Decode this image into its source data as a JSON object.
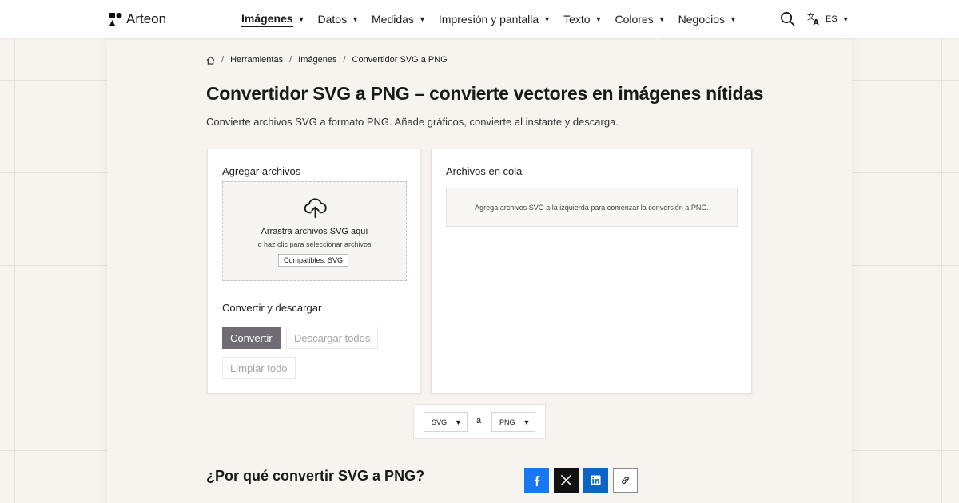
{
  "brand": {
    "name": "Arteon"
  },
  "nav": {
    "items": [
      {
        "label": "Imágenes",
        "active": true
      },
      {
        "label": "Datos"
      },
      {
        "label": "Medidas"
      },
      {
        "label": "Impresión y pantalla"
      },
      {
        "label": "Texto"
      },
      {
        "label": "Colores"
      },
      {
        "label": "Negocios"
      }
    ],
    "language": "ES"
  },
  "breadcrumb": {
    "items": [
      "Herramientas",
      "Imágenes",
      "Convertidor SVG a PNG"
    ]
  },
  "page": {
    "title": "Convertidor SVG a PNG – convierte vectores en imágenes nítidas",
    "subtitle": "Convierte archivos SVG a formato PNG. Añade gráficos, convierte al instante y descarga."
  },
  "add_files": {
    "heading": "Agregar archivos",
    "drop_title": "Arrastra archivos SVG aquí",
    "drop_sub": "o haz clic para seleccionar archivos",
    "badge": "Compatibles: SVG"
  },
  "convert": {
    "heading": "Convertir y descargar",
    "convert_label": "Convertir",
    "download_all_label": "Descargar todos",
    "clear_all_label": "Limpiar todo"
  },
  "queue": {
    "heading": "Archivos en cola",
    "empty_message": "Agrega archivos SVG a la izquierda para comenzar la conversión a PNG."
  },
  "format": {
    "from": "SVG",
    "connector": "a",
    "to": "PNG"
  },
  "why": {
    "heading": "¿Por qué convertir SVG a PNG?"
  },
  "share": {
    "buttons": [
      "facebook-icon",
      "x-icon",
      "linkedin-icon",
      "link-icon"
    ]
  },
  "colors": {
    "accent_button": "#6f6d73",
    "facebook": "#1877f2",
    "x": "#111111",
    "linkedin": "#0a66c2"
  }
}
